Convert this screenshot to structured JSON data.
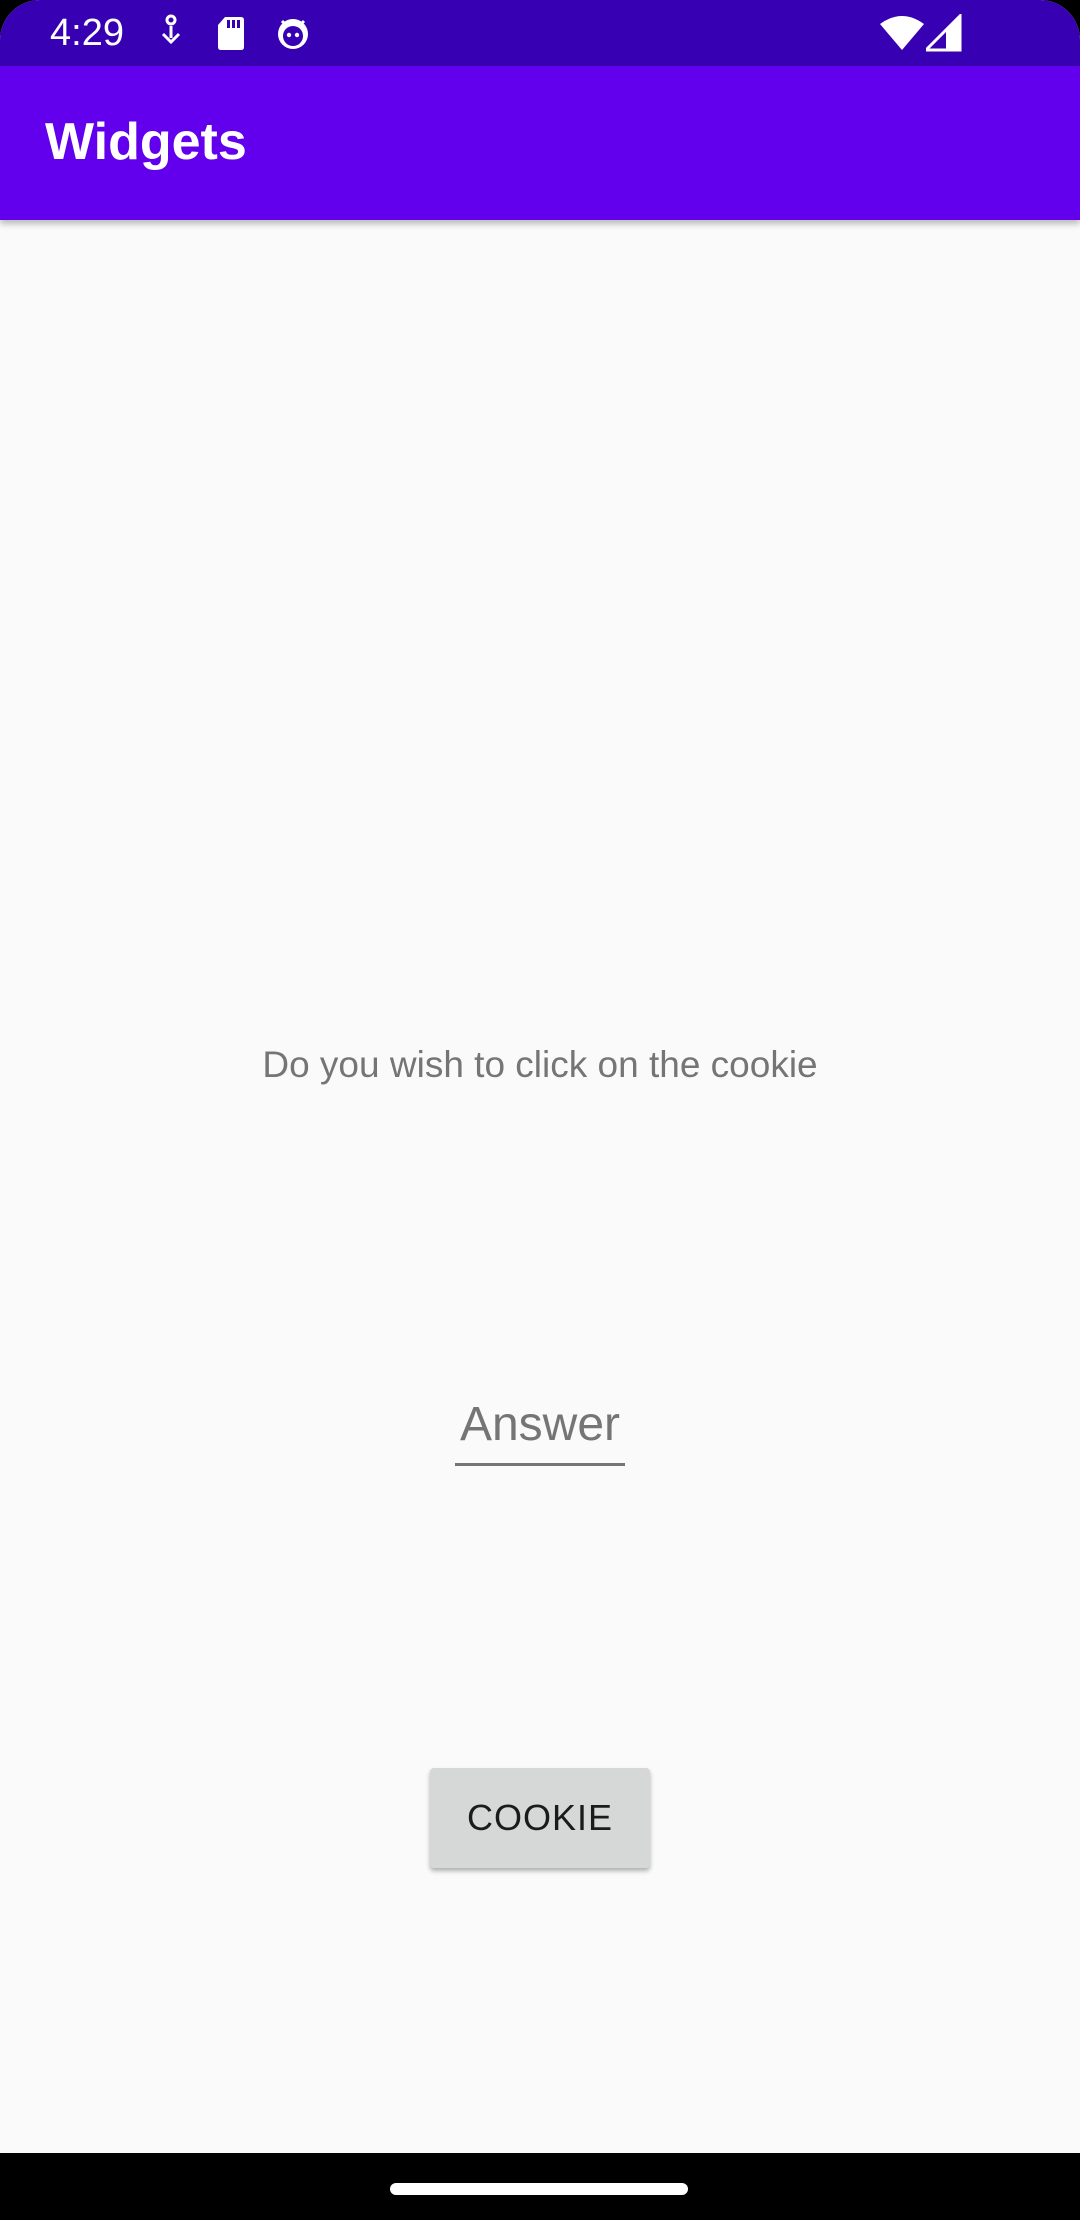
{
  "status_bar": {
    "time": "4:29",
    "icons_left": [
      "download-icon",
      "sd-card-icon",
      "android-icon"
    ],
    "icons_right": [
      "wifi-icon",
      "signal-icon"
    ]
  },
  "app_bar": {
    "title": "Widgets"
  },
  "main": {
    "question": "Do you wish to click on the cookie",
    "answer": {
      "value": "",
      "placeholder": "Answer"
    },
    "cookie_button_label": "COOKIE"
  },
  "colors": {
    "status_bar": "#3700B3",
    "app_bar": "#6200EE",
    "background": "#FAFAFA",
    "button": "#D6D7D7",
    "secondary_text": "#757575"
  }
}
